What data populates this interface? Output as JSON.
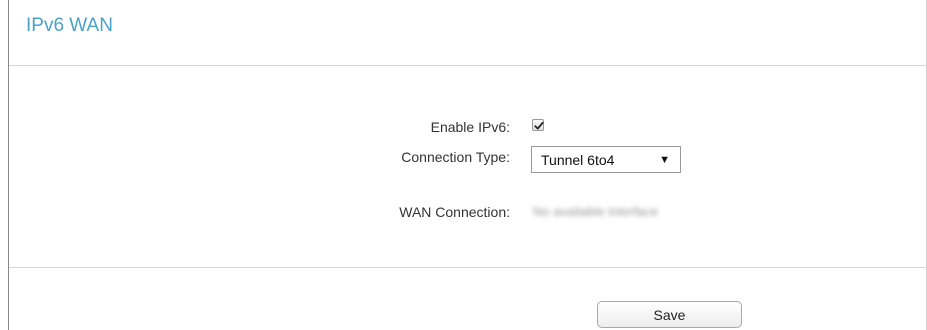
{
  "section": {
    "title": "IPv6 WAN"
  },
  "form": {
    "enable_ipv6": {
      "label": "Enable IPv6:",
      "checked": true
    },
    "connection_type": {
      "label": "Connection Type:",
      "selected": "Tunnel 6to4"
    },
    "wan_connection": {
      "label": "WAN Connection:",
      "value": "No available interface"
    }
  },
  "actions": {
    "save_label": "Save"
  },
  "colors": {
    "title": "#4aa3c8",
    "divider": "#d6d6d6",
    "label_text": "#333333"
  },
  "icons": {
    "checkbox": "checkmark-icon",
    "dropdown": "dropdown-arrow-icon"
  }
}
